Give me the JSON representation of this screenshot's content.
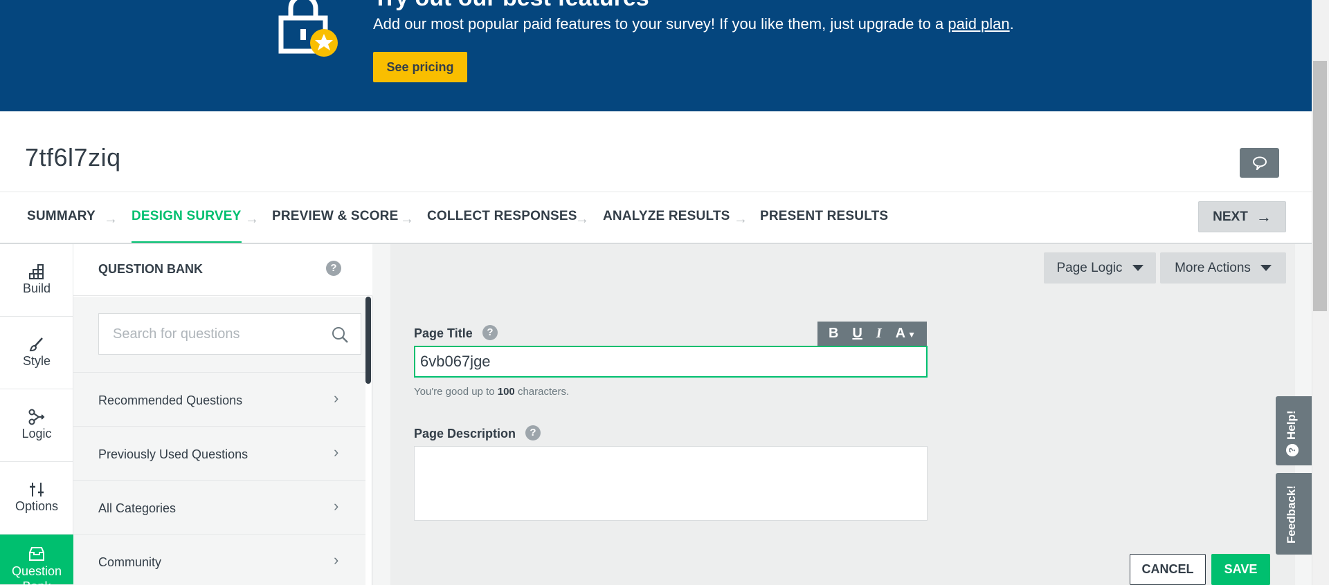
{
  "banner": {
    "title": "Try out our best features",
    "text_prefix": "Add our most popular paid features to your survey! If you like them, just upgrade to a ",
    "link": "paid plan",
    "text_suffix": ".",
    "cta": "See pricing"
  },
  "survey": {
    "title": "7tf6l7ziq"
  },
  "steps": {
    "items": [
      "SUMMARY",
      "DESIGN SURVEY",
      "PREVIEW & SCORE",
      "COLLECT RESPONSES",
      "ANALYZE RESULTS",
      "PRESENT RESULTS"
    ],
    "active": "DESIGN SURVEY",
    "next": "NEXT"
  },
  "rail": {
    "items": [
      "Build",
      "Style",
      "Logic",
      "Options",
      "Question Bank"
    ],
    "active": "Question Bank"
  },
  "question_bank": {
    "title": "QUESTION BANK",
    "search_placeholder": "Search for questions",
    "items": [
      "Recommended Questions",
      "Previously Used Questions",
      "All Categories",
      "Community"
    ]
  },
  "page_editor": {
    "page_logic": "Page Logic",
    "more_actions": "More Actions",
    "page_title_label": "Page Title",
    "page_title_value": "6vb067jge",
    "format_buttons": [
      "B",
      "U",
      "I",
      "A"
    ],
    "char_note_prefix": "You're good up to ",
    "char_limit": "100",
    "char_note_suffix": " characters.",
    "description_label": "Page Description",
    "cancel": "CANCEL",
    "save": "SAVE"
  },
  "side_tabs": {
    "help": "Help!",
    "feedback": "Feedback!"
  },
  "colors": {
    "banner": "#05467e",
    "accent": "#00bf6f",
    "cta": "#f9be00"
  }
}
